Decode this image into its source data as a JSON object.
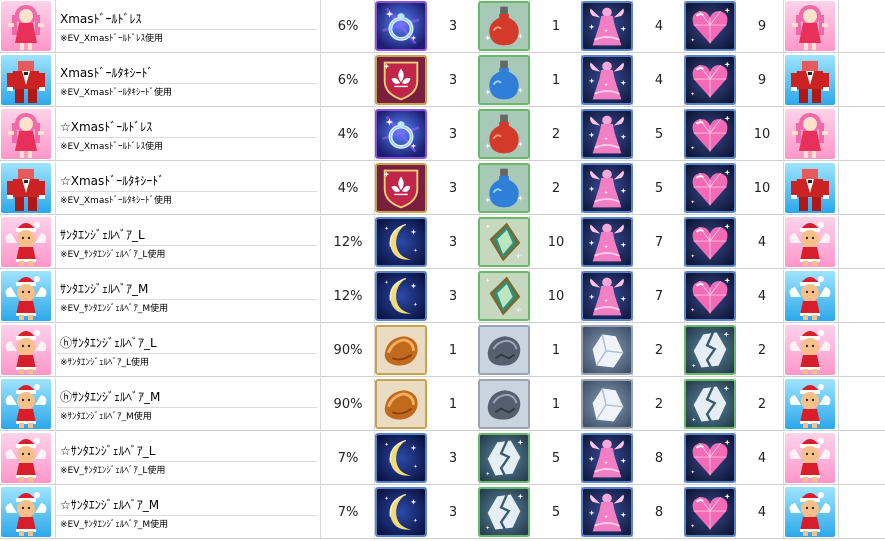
{
  "rows": [
    {
      "avatar": "doll-dress-icon",
      "avatar_bg": "pink",
      "name": "Xmasﾄﾞｰﾙﾄﾞﾚｽ",
      "sub": "※EV_Xmasﾄﾞｰﾙﾄﾞﾚｽ使用",
      "rate": "6%",
      "items": [
        {
          "icon": "ring-icon",
          "count": "3"
        },
        {
          "icon": "red-potion-icon",
          "count": "1"
        },
        {
          "icon": "pink-dress-icon",
          "count": "4"
        },
        {
          "icon": "pink-heart-gem-icon",
          "count": "9"
        }
      ]
    },
    {
      "avatar": "tuxedo-icon",
      "avatar_bg": "blue",
      "name": "Xmasﾄﾞｰﾙﾀｷｼｰﾄﾞ",
      "sub": "※EV_Xmasﾄﾞｰﾙﾀｷｼｰﾄﾞ使用",
      "rate": "6%",
      "items": [
        {
          "icon": "fleur-shield-icon",
          "count": "3"
        },
        {
          "icon": "blue-potion-icon",
          "count": "1"
        },
        {
          "icon": "pink-dress-icon",
          "count": "4"
        },
        {
          "icon": "pink-heart-gem-icon",
          "count": "9"
        }
      ]
    },
    {
      "avatar": "doll-dress-icon",
      "avatar_bg": "pink",
      "name": "☆Xmasﾄﾞｰﾙﾄﾞﾚｽ",
      "sub": "※EV_Xmasﾄﾞｰﾙﾄﾞﾚｽ使用",
      "rate": "4%",
      "items": [
        {
          "icon": "ring-icon",
          "count": "3"
        },
        {
          "icon": "red-potion-icon",
          "count": "2"
        },
        {
          "icon": "pink-dress-icon",
          "count": "5"
        },
        {
          "icon": "pink-heart-gem-icon",
          "count": "10"
        }
      ]
    },
    {
      "avatar": "tuxedo-icon",
      "avatar_bg": "blue",
      "name": "☆Xmasﾄﾞｰﾙﾀｷｼｰﾄﾞ",
      "sub": "※EV_Xmasﾄﾞｰﾙﾀｷｼｰﾄﾞ使用",
      "rate": "4%",
      "items": [
        {
          "icon": "fleur-shield-icon",
          "count": "3"
        },
        {
          "icon": "blue-potion-icon",
          "count": "2"
        },
        {
          "icon": "pink-dress-icon",
          "count": "5"
        },
        {
          "icon": "pink-heart-gem-icon",
          "count": "10"
        }
      ]
    },
    {
      "avatar": "santa-angel-icon",
      "avatar_bg": "pink",
      "name": "ｻﾝﾀｴﾝｼﾞｪﾙﾍﾞｱ_L",
      "sub": "※EV_ｻﾝﾀｴﾝｼﾞｪﾙﾍﾞｱ_L使用",
      "rate": "12%",
      "items": [
        {
          "icon": "crescent-moon-icon",
          "count": "3"
        },
        {
          "icon": "green-card-icon",
          "count": "10"
        },
        {
          "icon": "pink-dress-icon",
          "count": "7"
        },
        {
          "icon": "pink-heart-gem-icon",
          "count": "4"
        }
      ]
    },
    {
      "avatar": "santa-angel-icon",
      "avatar_bg": "blue",
      "name": "ｻﾝﾀｴﾝｼﾞｪﾙﾍﾞｱ_M",
      "sub": "※EV_ｻﾝﾀｴﾝｼﾞｪﾙﾍﾞｱ_M使用",
      "rate": "12%",
      "items": [
        {
          "icon": "crescent-moon-icon",
          "count": "3"
        },
        {
          "icon": "green-card-icon",
          "count": "10"
        },
        {
          "icon": "pink-dress-icon",
          "count": "7"
        },
        {
          "icon": "pink-heart-gem-icon",
          "count": "4"
        }
      ]
    },
    {
      "avatar": "santa-angel-icon",
      "avatar_bg": "pink",
      "name": "ⓗｻﾝﾀｴﾝｼﾞｪﾙﾍﾞｱ_L",
      "sub": "※ｻﾝﾀｴﾝｼﾞｪﾙﾍﾞｱ_L使用",
      "rate": "90%",
      "items": [
        {
          "icon": "copper-ore-icon",
          "count": "1"
        },
        {
          "icon": "dark-ore-icon",
          "count": "1"
        },
        {
          "icon": "white-crystal-icon",
          "count": "2"
        },
        {
          "icon": "cracked-crystal-icon",
          "count": "2"
        }
      ]
    },
    {
      "avatar": "santa-angel-icon",
      "avatar_bg": "blue",
      "name": "ⓗｻﾝﾀｴﾝｼﾞｪﾙﾍﾞｱ_M",
      "sub": "※ｻﾝﾀｴﾝｼﾞｪﾙﾍﾞｱ_M使用",
      "rate": "90%",
      "items": [
        {
          "icon": "copper-ore-icon",
          "count": "1"
        },
        {
          "icon": "dark-ore-icon",
          "count": "1"
        },
        {
          "icon": "white-crystal-icon",
          "count": "2"
        },
        {
          "icon": "cracked-crystal-icon",
          "count": "2"
        }
      ]
    },
    {
      "avatar": "santa-angel-icon",
      "avatar_bg": "pink",
      "name": "☆ｻﾝﾀｴﾝｼﾞｪﾙﾍﾞｱ_L",
      "sub": "※EV_ｻﾝﾀｴﾝｼﾞｪﾙﾍﾞｱ_L使用",
      "rate": "7%",
      "items": [
        {
          "icon": "crescent-moon-icon",
          "count": "3"
        },
        {
          "icon": "cracked-crystal-icon",
          "count": "5"
        },
        {
          "icon": "pink-dress-icon",
          "count": "8"
        },
        {
          "icon": "pink-heart-gem-icon",
          "count": "4"
        }
      ]
    },
    {
      "avatar": "santa-angel-icon",
      "avatar_bg": "blue",
      "name": "☆ｻﾝﾀｴﾝｼﾞｪﾙﾍﾞｱ_M",
      "sub": "※EV_ｻﾝﾀｴﾝｼﾞｪﾙﾍﾞｱ_M使用",
      "rate": "7%",
      "items": [
        {
          "icon": "crescent-moon-icon",
          "count": "3"
        },
        {
          "icon": "cracked-crystal-icon",
          "count": "5"
        },
        {
          "icon": "pink-dress-icon",
          "count": "8"
        },
        {
          "icon": "pink-heart-gem-icon",
          "count": "4"
        }
      ]
    }
  ]
}
